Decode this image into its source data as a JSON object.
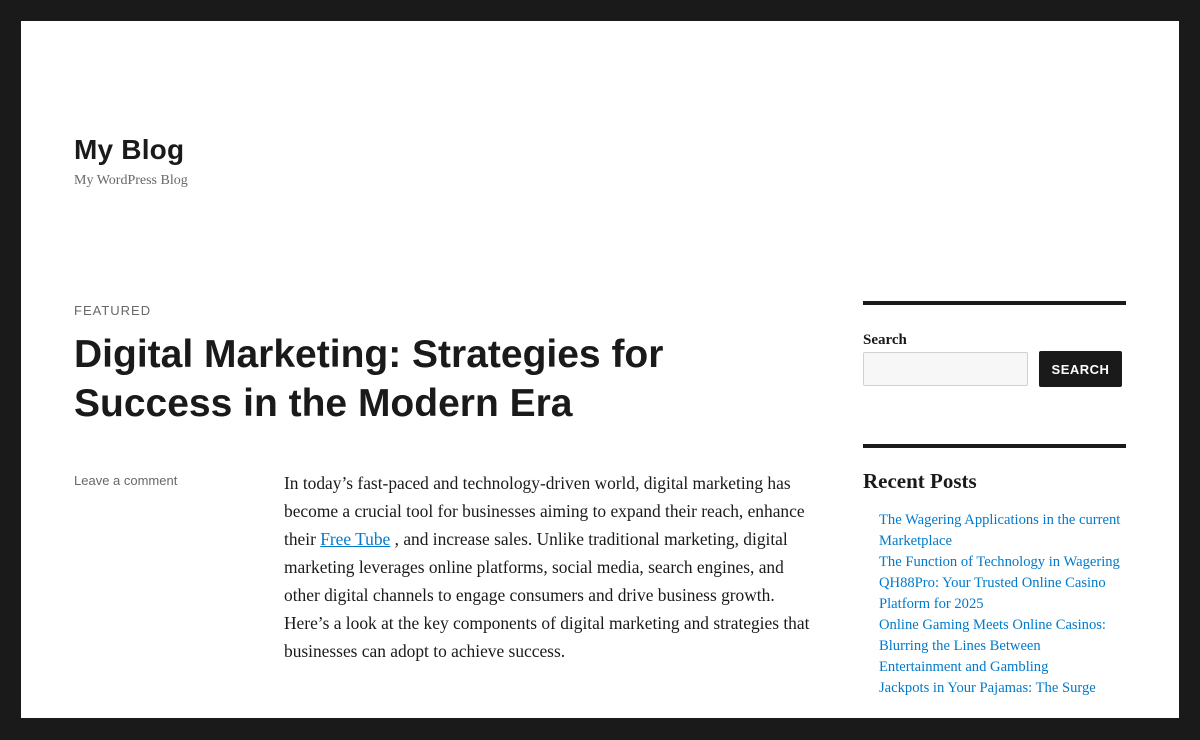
{
  "site": {
    "title": "My Blog",
    "description": "My WordPress Blog"
  },
  "post": {
    "sticky_label": "FEATURED",
    "title": "Digital Marketing: Strategies for Success in the Modern Era",
    "comment_link": "Leave a comment",
    "content": {
      "before_link": "In today’s fast-paced and technology-driven world, digital marketing has become a crucial tool for businesses aiming to expand their reach, enhance their ",
      "link_text": "Free Tube",
      "after_link": " , and increase sales. Unlike traditional marketing, digital marketing leverages online platforms, social media, search engines, and other digital channels to engage consumers and drive business growth. Here’s a look at the key components of digital marketing and strategies that businesses can adopt to achieve success."
    }
  },
  "sidebar": {
    "search": {
      "label": "Search",
      "input_value": "",
      "button_label": "SEARCH"
    },
    "recent_posts": {
      "title": "Recent Posts",
      "items": [
        "The Wagering Applications in the current Marketplace",
        "The Function of Technology in Wagering",
        "QH88Pro: Your Trusted Online Casino Platform for 2025",
        "Online Gaming Meets Online Casinos: Blurring the Lines Between Entertainment and Gambling",
        "Jackpots in Your Pajamas: The Surge"
      ]
    }
  },
  "colors": {
    "frame": "#1a1a1a",
    "background": "#ffffff",
    "text": "#1a1a1a",
    "muted": "#686868",
    "link": "#007acc"
  }
}
